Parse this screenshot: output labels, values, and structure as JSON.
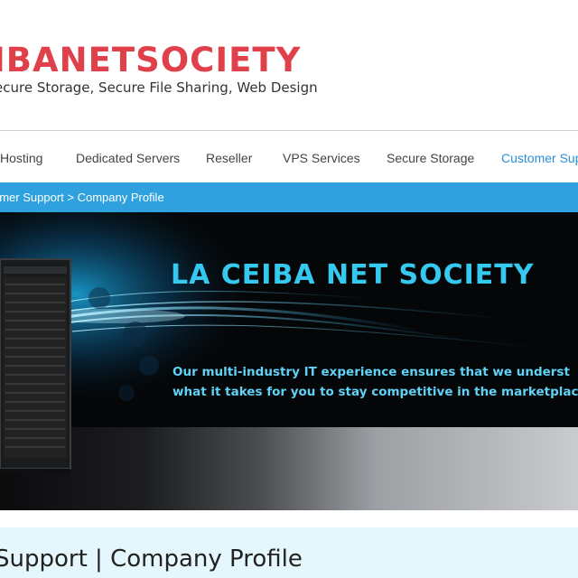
{
  "header": {
    "logo_text": "IBANETSOCIETY",
    "tagline": "ecure Storage,  Secure File Sharing, Web Design"
  },
  "nav": {
    "items": [
      {
        "label": "Hosting"
      },
      {
        "label": "Dedicated Servers"
      },
      {
        "label": "Reseller"
      },
      {
        "label": "VPS Services"
      },
      {
        "label": "Secure Storage"
      },
      {
        "label": "Customer Supp",
        "active": true
      }
    ]
  },
  "breadcrumb": {
    "text": "omer Support > Company Profile"
  },
  "banner": {
    "title": "LA CEIBA NET SOCIETY",
    "line1": "Our multi-industry IT experience ensures that we underst",
    "line2": "what it takes for you to stay competitive in the marketplac"
  },
  "page": {
    "title": "Support | Company Profile"
  },
  "colors": {
    "logo": "#e0404a",
    "accent": "#2fa1de",
    "active_nav": "#2a8fd6",
    "banner_text": "#36c9f0",
    "heading_bg": "#e4f7fd"
  }
}
